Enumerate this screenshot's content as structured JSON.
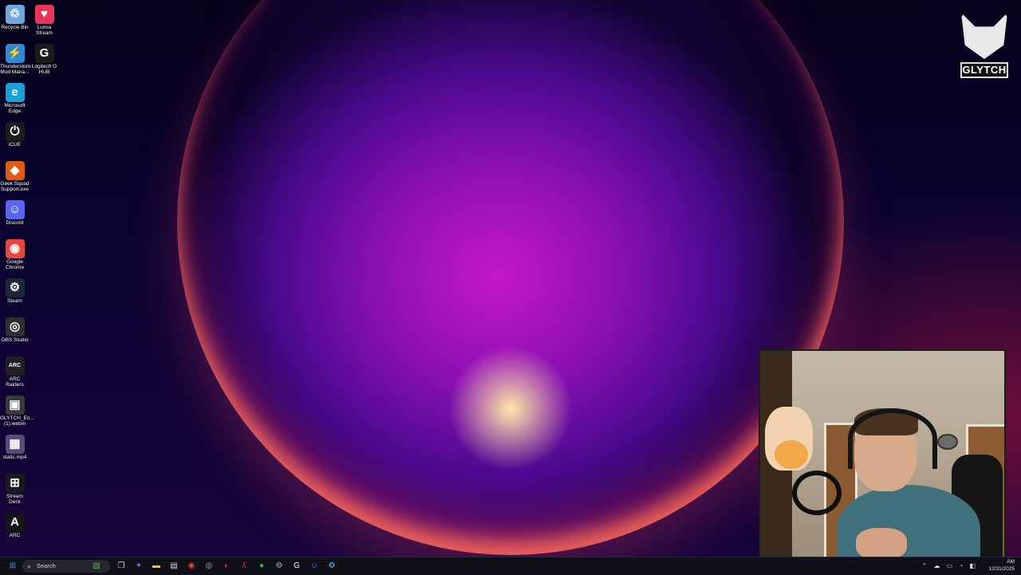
{
  "desktop": {
    "icons": [
      {
        "label": "Recycle Bin",
        "icon": "recycle-bin-icon",
        "color": "#6fa8dc",
        "glyph": "♲"
      },
      {
        "label": "Lumia Stream",
        "icon": "lumia-stream-icon",
        "color": "#e8355a",
        "glyph": "♥"
      },
      {
        "label": "Thunderstore Mod Mana...",
        "icon": "thunderstore-icon",
        "color": "#2b8bd6",
        "glyph": "⚡"
      },
      {
        "label": "Logitech G HUB",
        "icon": "logitech-g-hub-icon",
        "color": "#1b1b1b",
        "glyph": "G"
      },
      {
        "label": "Microsoft Edge",
        "icon": "edge-icon",
        "color": "#1a9ed6",
        "glyph": "e"
      },
      {
        "label": "iCUE",
        "icon": "icue-icon",
        "color": "#1c1c1c",
        "glyph": "⏻"
      },
      {
        "label": "Geek Squad Support.exe",
        "icon": "geek-squad-icon",
        "color": "#e35a16",
        "glyph": "◆"
      },
      {
        "label": "Discord",
        "icon": "discord-icon",
        "color": "#5865f2",
        "glyph": "☺"
      },
      {
        "label": "Google Chrome",
        "icon": "chrome-icon",
        "color": "#e8453c",
        "glyph": "◉"
      },
      {
        "label": "Steam",
        "icon": "steam-icon",
        "color": "#1b2838",
        "glyph": "⚙"
      },
      {
        "label": "OBS Studio",
        "icon": "obs-icon",
        "color": "#2f2f2f",
        "glyph": "◎"
      },
      {
        "label": "ARC Raiders",
        "icon": "arc-raiders-icon",
        "color": "#202020",
        "glyph": "ARC"
      },
      {
        "label": "GLYTCH_En... (1).webm",
        "icon": "webm-file-icon",
        "color": "#3a3a3a",
        "glyph": "▣"
      },
      {
        "label": "static.mp4",
        "icon": "mp4-file-icon",
        "color": "#5a4a7a",
        "glyph": "▦"
      },
      {
        "label": "Stream Deck",
        "icon": "stream-deck-icon",
        "color": "#1a1a1a",
        "glyph": "⊞"
      },
      {
        "label": "ARC",
        "icon": "arc-icon",
        "color": "#151515",
        "glyph": "A"
      }
    ]
  },
  "logo": {
    "word": "GLYTCH",
    "icon": "glytch-fox-logo"
  },
  "webcam": {
    "label": "webcam-overlay"
  },
  "taskbar": {
    "search_placeholder": "Search",
    "apps": [
      {
        "name": "start-button",
        "glyph": "⊞",
        "color": "#3a8ee6"
      },
      {
        "name": "widgets",
        "glyph": "▨",
        "color": "#6aa84f"
      },
      {
        "name": "task-view",
        "glyph": "❐",
        "color": "#cccccc"
      },
      {
        "name": "copilot",
        "glyph": "✦",
        "color": "#7a6df0"
      },
      {
        "name": "file-explorer",
        "glyph": "▬",
        "color": "#f1c232"
      },
      {
        "name": "microsoft-store",
        "glyph": "▤",
        "color": "#dddddd"
      },
      {
        "name": "chrome",
        "glyph": "◉",
        "color": "#e8453c"
      },
      {
        "name": "icue",
        "glyph": "◍",
        "color": "#888888"
      },
      {
        "name": "lumia",
        "glyph": "◐",
        "color": "#cc3344"
      },
      {
        "name": "acrobat",
        "glyph": "ʎ",
        "color": "#d9302c"
      },
      {
        "name": "spotify",
        "glyph": "●",
        "color": "#1db954"
      },
      {
        "name": "steam",
        "glyph": "⚙",
        "color": "#9ab"
      },
      {
        "name": "logitech",
        "glyph": "G",
        "color": "#ffffff"
      },
      {
        "name": "discord",
        "glyph": "☺",
        "color": "#5865f2"
      },
      {
        "name": "steam-2",
        "glyph": "⚙",
        "color": "#66c0f4"
      }
    ],
    "time": "AM",
    "date": "12/31/2025"
  }
}
